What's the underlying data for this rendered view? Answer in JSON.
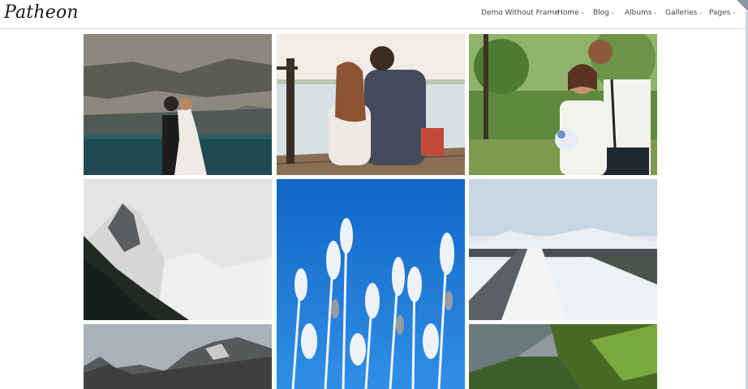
{
  "site": {
    "logo": "Patheon"
  },
  "nav": {
    "items": [
      {
        "label": "Demo Without Frame",
        "has_dropdown": false
      },
      {
        "label": "Home",
        "has_dropdown": true
      },
      {
        "label": "Blog",
        "has_dropdown": true
      },
      {
        "label": "Albums",
        "has_dropdown": true
      },
      {
        "label": "Galleries",
        "has_dropdown": true
      },
      {
        "label": "Pages",
        "has_dropdown": true
      }
    ],
    "chevron": "⌄"
  },
  "gallery": {
    "photos": [
      {
        "subject": "couple-lake-cliffs",
        "icon": "photo"
      },
      {
        "subject": "couple-on-pier",
        "icon": "photo"
      },
      {
        "subject": "bride-groom-forest",
        "icon": "photo"
      },
      {
        "subject": "snowy-mountain-peak",
        "icon": "photo"
      },
      {
        "subject": "frosted-plants-blue-sky",
        "icon": "photo"
      },
      {
        "subject": "snowy-road",
        "icon": "photo"
      },
      {
        "subject": "rocky-mountain-ridge",
        "icon": "photo"
      },
      {
        "subject": "green-valley-hills",
        "icon": "photo"
      }
    ]
  },
  "colors": {
    "nav_border": "#cfe0ee",
    "nav_text": "#444444"
  }
}
